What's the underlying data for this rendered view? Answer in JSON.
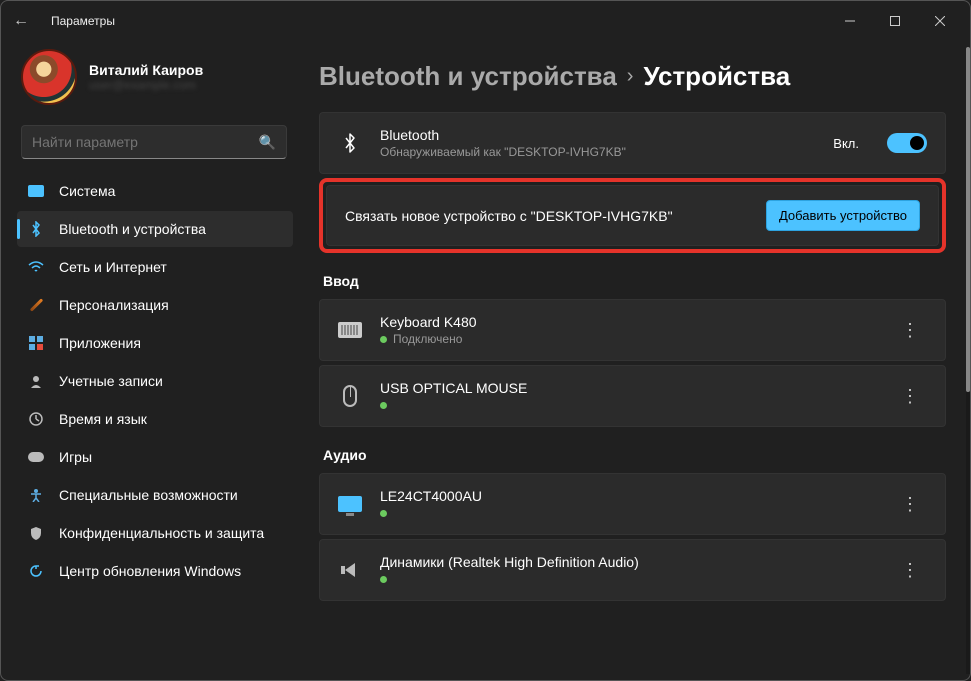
{
  "window": {
    "title": "Параметры"
  },
  "profile": {
    "name": "Виталий Каиров",
    "email": "user@example.com"
  },
  "search": {
    "placeholder": "Найти параметр"
  },
  "nav": [
    {
      "icon": "system",
      "label": "Система",
      "color": "#4cc2ff"
    },
    {
      "icon": "bluetooth",
      "label": "Bluetooth и устройства",
      "color": "#4cc2ff",
      "active": true
    },
    {
      "icon": "network",
      "label": "Сеть и Интернет",
      "color": "#4cc2ff"
    },
    {
      "icon": "personalize",
      "label": "Персонализация",
      "color": "#e67e22"
    },
    {
      "icon": "apps",
      "label": "Приложения",
      "color": "#5dade2"
    },
    {
      "icon": "accounts",
      "label": "Учетные записи",
      "color": "#bbb"
    },
    {
      "icon": "time",
      "label": "Время и язык",
      "color": "#bbb"
    },
    {
      "icon": "games",
      "label": "Игры",
      "color": "#bbb"
    },
    {
      "icon": "accessibility",
      "label": "Специальные возможности",
      "color": "#5dade2"
    },
    {
      "icon": "privacy",
      "label": "Конфиденциальность и защита",
      "color": "#bbb"
    },
    {
      "icon": "update",
      "label": "Центр обновления Windows",
      "color": "#4cc2ff"
    }
  ],
  "breadcrumb": {
    "parent": "Bluetooth и устройства",
    "current": "Устройства"
  },
  "bluetooth": {
    "title": "Bluetooth",
    "subtitle": "Обнаруживаемый как \"DESKTOP-IVHG7KB\"",
    "state_label": "Вкл.",
    "on": true
  },
  "pair": {
    "text": "Связать новое устройство с \"DESKTOP-IVHG7KB\"",
    "button": "Добавить устройство"
  },
  "sections": {
    "input": {
      "heading": "Ввод",
      "items": [
        {
          "type": "keyboard",
          "name": "Keyboard K480",
          "status": "Подключено"
        },
        {
          "type": "mouse",
          "name": "USB OPTICAL MOUSE",
          "status": ""
        }
      ]
    },
    "audio": {
      "heading": "Аудио",
      "items": [
        {
          "type": "monitor",
          "name": "LE24CT4000AU",
          "status": ""
        },
        {
          "type": "speaker",
          "name": "Динамики (Realtek High Definition Audio)",
          "status": ""
        }
      ]
    }
  }
}
